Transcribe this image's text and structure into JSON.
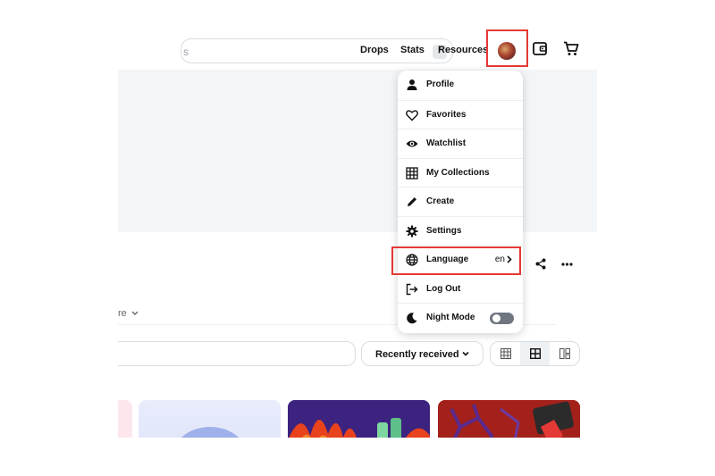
{
  "header": {
    "search": {
      "placeholder": "s",
      "shortcut": "/"
    },
    "nav": [
      {
        "label": "Drops"
      },
      {
        "label": "Stats"
      },
      {
        "label": "Resources"
      }
    ]
  },
  "page": {
    "more_label": "re",
    "sort": {
      "selected": "Recently received"
    }
  },
  "account_menu": {
    "items": [
      {
        "label": "Profile",
        "icon": "person-icon"
      },
      {
        "label": "Favorites",
        "icon": "heart-icon"
      },
      {
        "label": "Watchlist",
        "icon": "eye-icon"
      },
      {
        "label": "My Collections",
        "icon": "grid-icon"
      },
      {
        "label": "Create",
        "icon": "pencil-icon"
      },
      {
        "label": "Settings",
        "icon": "gear-icon"
      },
      {
        "label": "Language",
        "icon": "globe-icon",
        "value": "en"
      },
      {
        "label": "Log Out",
        "icon": "logout-icon"
      },
      {
        "label": "Night Mode",
        "icon": "moon-icon",
        "toggle": false
      }
    ]
  },
  "colors": {
    "highlight": "#e53935",
    "text": "#121212",
    "hero_bg": "#f3f6f8"
  }
}
